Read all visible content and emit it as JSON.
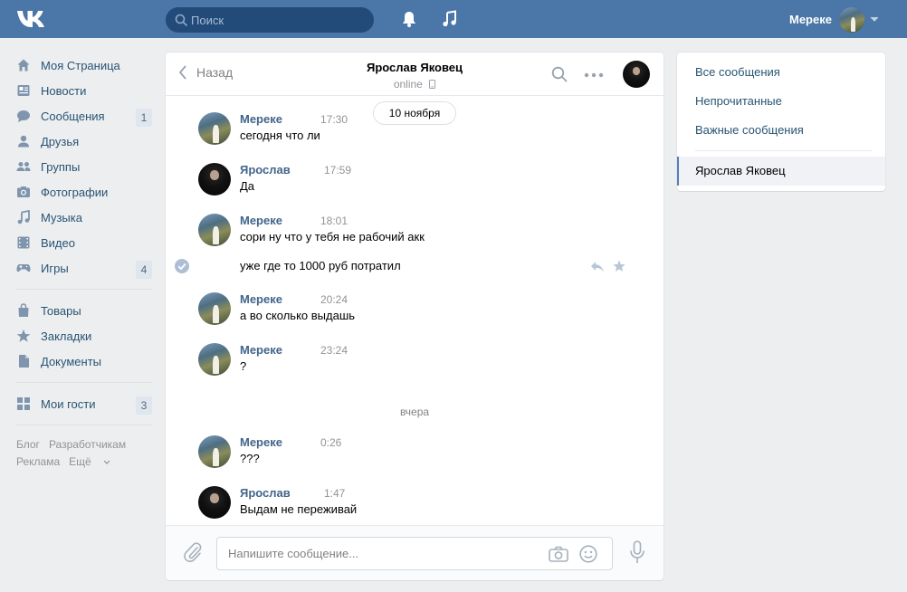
{
  "header": {
    "search_placeholder": "Поиск",
    "username": "Мереке",
    "brand_color": "#4a76a8"
  },
  "sidebar": {
    "items": [
      {
        "label": "Моя Страница",
        "icon": "home-icon"
      },
      {
        "label": "Новости",
        "icon": "news-icon"
      },
      {
        "label": "Сообщения",
        "icon": "messages-icon",
        "count": "1"
      },
      {
        "label": "Друзья",
        "icon": "friends-icon"
      },
      {
        "label": "Группы",
        "icon": "groups-icon"
      },
      {
        "label": "Фотографии",
        "icon": "photos-icon"
      },
      {
        "label": "Музыка",
        "icon": "music-icon"
      },
      {
        "label": "Видео",
        "icon": "video-icon"
      },
      {
        "label": "Игры",
        "icon": "games-icon",
        "count": "4"
      },
      {
        "label": "Товары",
        "icon": "goods-icon"
      },
      {
        "label": "Закладки",
        "icon": "bookmarks-icon"
      },
      {
        "label": "Документы",
        "icon": "documents-icon"
      },
      {
        "label": "Мои гости",
        "icon": "guests-icon",
        "count": "3"
      }
    ],
    "footer": {
      "blog": "Блог",
      "developers": "Разработчикам",
      "ads": "Реклама",
      "more": "Ещё"
    }
  },
  "chat": {
    "back_label": "Назад",
    "title": "Ярослав Яковец",
    "status": "online",
    "date_pill": "10 ноября",
    "divider_yesterday": "вчера",
    "messages": [
      {
        "author": "Мереке",
        "time": "17:30",
        "text": "сегодня что ли"
      },
      {
        "author": "Ярослав",
        "time": "17:59",
        "text": "Да"
      },
      {
        "author": "Мереке",
        "time": "18:01",
        "text": "сори ну что у тебя не рабочий акк",
        "extra": "уже где то 1000 руб потратил"
      },
      {
        "author": "Мереке",
        "time": "20:24",
        "text": "а во сколько выдашь"
      },
      {
        "author": "Мереке",
        "time": "23:24",
        "text": "?"
      },
      {
        "author": "Мереке",
        "time": "0:26",
        "text": "???"
      },
      {
        "author": "Ярослав",
        "time": "1:47",
        "text": "Выдам не переживай"
      }
    ],
    "composer_placeholder": "Напишите сообщение..."
  },
  "right_panel": {
    "all": "Все сообщения",
    "unread": "Непрочитанные",
    "important": "Важные сообщения",
    "active_dialog": "Ярослав Яковец"
  }
}
